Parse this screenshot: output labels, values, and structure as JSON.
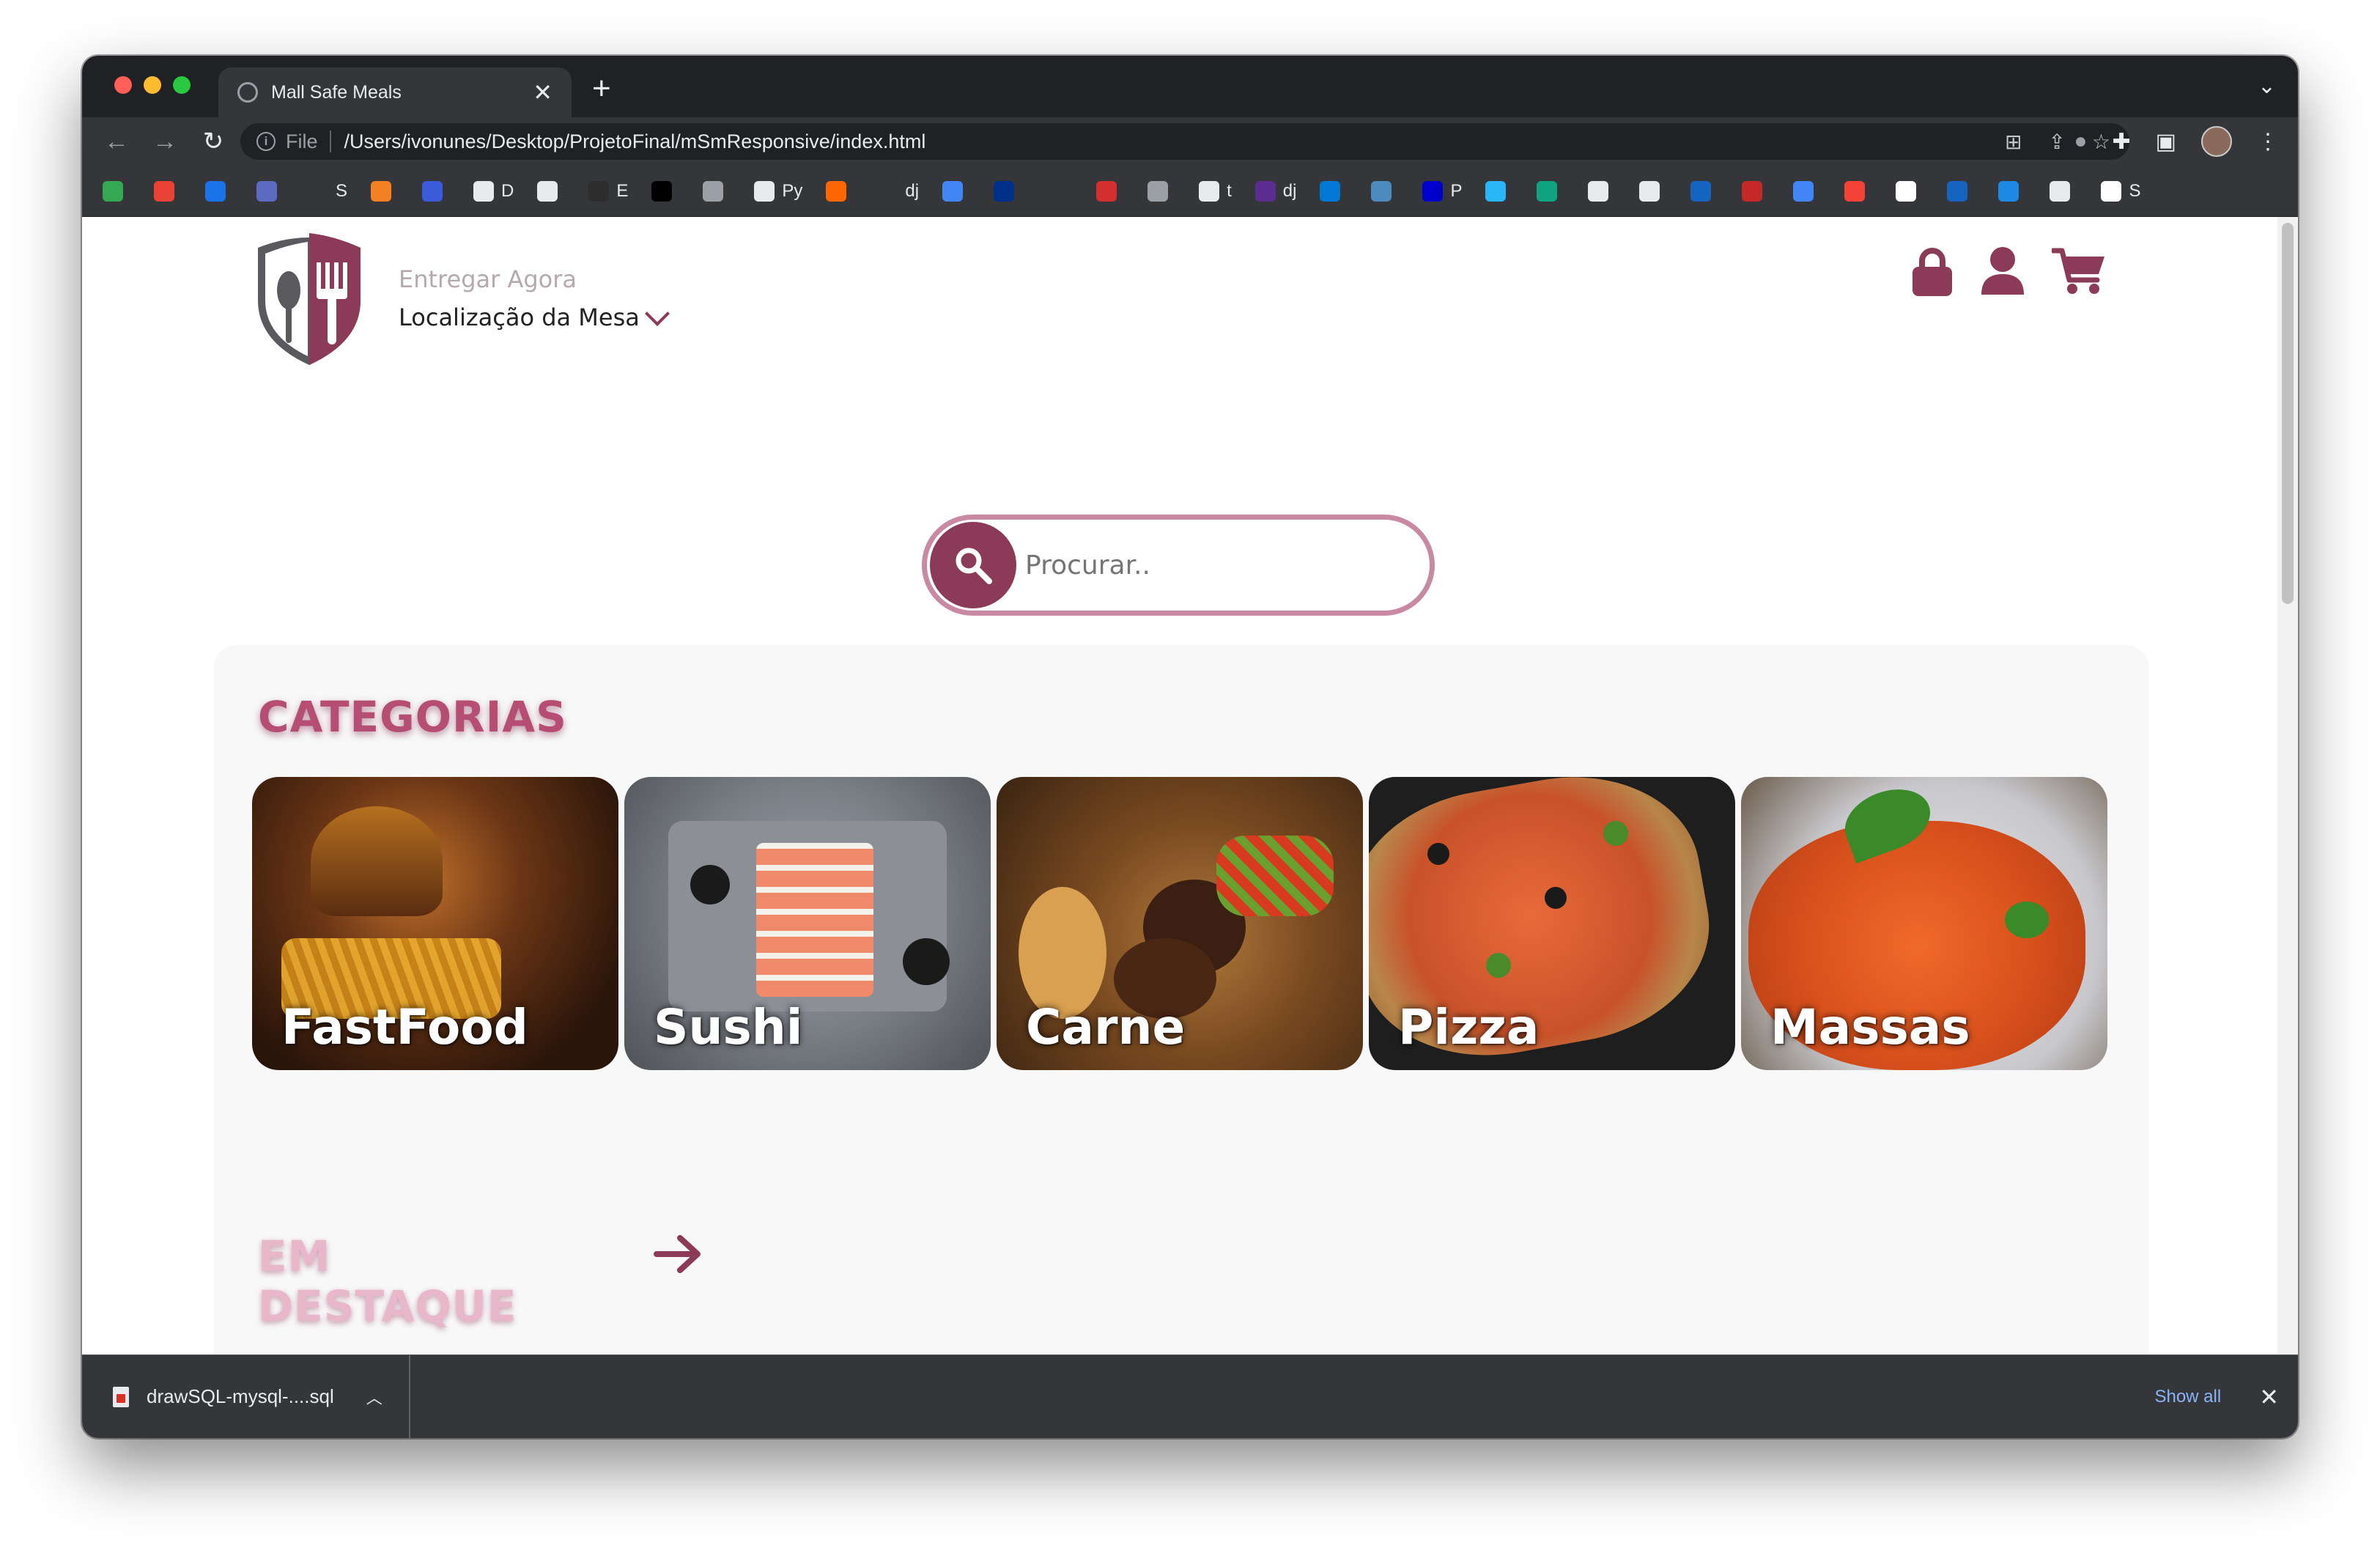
{
  "browser": {
    "tab_title": "Mall Safe Meals",
    "close_tab": "✕",
    "new_tab": "+",
    "tab_menu": "⌄",
    "url_scheme": "File",
    "url_path": "/Users/ivonunes/Desktop/ProjetoFinal/mSmResponsive/index.html",
    "bookmarks": [
      {
        "label": "",
        "color": "#34a853"
      },
      {
        "label": "",
        "color": "#ea4335"
      },
      {
        "label": "",
        "color": "#1a73e8"
      },
      {
        "label": "",
        "color": "#5c6bc0"
      },
      {
        "label": "S",
        "color": "transparent"
      },
      {
        "label": "",
        "color": "#f48024"
      },
      {
        "label": "",
        "color": "#3b5bdb"
      },
      {
        "label": "D",
        "color": "#e8eaed"
      },
      {
        "label": "",
        "color": "#e8eaed"
      },
      {
        "label": "E",
        "color": "#2d2d2d"
      },
      {
        "label": "",
        "color": "#000000"
      },
      {
        "label": "",
        "color": "#9aa0a6"
      },
      {
        "label": "Py",
        "color": "#e8eaed"
      },
      {
        "label": "",
        "color": "#ff6600"
      },
      {
        "label": "dj",
        "color": "transparent"
      },
      {
        "label": "",
        "color": "#4285f4"
      },
      {
        "label": "",
        "color": "#003087"
      },
      {
        "label": "",
        "color": "transparent"
      },
      {
        "label": "",
        "color": "#d32f2f"
      },
      {
        "label": "",
        "color": "#9aa0a6"
      },
      {
        "label": "t",
        "color": "#e8eaed"
      },
      {
        "label": "dj",
        "color": "#5c2d91"
      },
      {
        "label": "",
        "color": "#0078d4"
      },
      {
        "label": "",
        "color": "#4b8bbe"
      },
      {
        "label": "P",
        "color": "#0000cc"
      },
      {
        "label": "",
        "color": "#29b6f6"
      },
      {
        "label": "",
        "color": "#10a37f"
      },
      {
        "label": "",
        "color": "#e8eaed"
      },
      {
        "label": "",
        "color": "#e8eaed"
      },
      {
        "label": "",
        "color": "#1565c0"
      },
      {
        "label": "",
        "color": "#c62828"
      },
      {
        "label": "",
        "color": "#4285f4"
      },
      {
        "label": "",
        "color": "#f44336"
      },
      {
        "label": "",
        "color": "#ffffff"
      },
      {
        "label": "",
        "color": "#1565c0"
      },
      {
        "label": "",
        "color": "#1e88e5"
      },
      {
        "label": "",
        "color": "#e8eaed"
      },
      {
        "label": "S",
        "color": "#ffffff"
      }
    ]
  },
  "header": {
    "deliver_now": "Entregar Agora",
    "table_location": "Localização da Mesa",
    "brand_color": "#8b3a57",
    "icons": [
      "lock-icon",
      "user-icon",
      "cart-icon"
    ]
  },
  "search": {
    "placeholder": "Procurar.."
  },
  "categories": {
    "title": "CATEGORIAS",
    "items": [
      {
        "label": "FastFood"
      },
      {
        "label": "Sushi"
      },
      {
        "label": "Carne"
      },
      {
        "label": "Pizza"
      },
      {
        "label": "Massas"
      }
    ]
  },
  "featured": {
    "title": "EM DESTAQUE"
  },
  "downloads": {
    "file_name": "drawSQL-mysql-....sql",
    "show_all": "Show all",
    "close": "✕"
  }
}
